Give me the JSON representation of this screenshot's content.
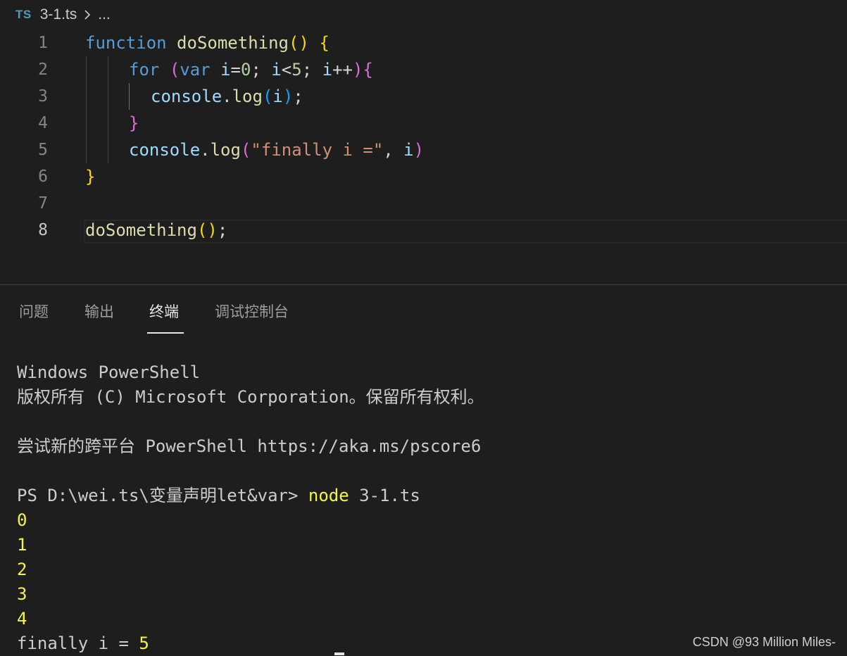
{
  "breadcrumb": {
    "lang_badge": "TS",
    "file": "3-1.ts",
    "more": "..."
  },
  "editor": {
    "line_numbers": [
      "1",
      "2",
      "3",
      "4",
      "5",
      "6",
      "7",
      "8"
    ],
    "current_line": "8",
    "code": {
      "l1": {
        "kw": "function",
        "name": "doSomething",
        "parens": "()",
        "brace": "{"
      },
      "l2": {
        "kw_for": "for",
        "open_paren": "(",
        "kw_var": "var",
        "var_i": "i",
        "eq": "=",
        "zero": "0",
        "semi1": "; ",
        "i2": "i",
        "lt": "<",
        "five": "5",
        "semi2": "; ",
        "i3": "i",
        "inc": "++",
        "close_paren": ")",
        "brace": "{"
      },
      "l3": {
        "obj": "console",
        "dot": ".",
        "method": "log",
        "open": "(",
        "arg": "i",
        "close": ")",
        "semi": ";"
      },
      "l4": {
        "brace": "}"
      },
      "l5": {
        "obj": "console",
        "dot": ".",
        "method": "log",
        "open": "(",
        "str": "\"finally i =\"",
        "comma": ", ",
        "arg": "i",
        "close": ")"
      },
      "l6": {
        "brace": "}"
      },
      "l8": {
        "name": "doSomething",
        "parens": "()",
        "semi": ";"
      }
    }
  },
  "panel": {
    "tabs": [
      "问题",
      "输出",
      "终端",
      "调试控制台"
    ],
    "active_tab": "终端"
  },
  "terminal": {
    "line1": "Windows PowerShell",
    "line2": "版权所有 (C) Microsoft Corporation。保留所有权利。",
    "line3": "尝试新的跨平台 PowerShell https://aka.ms/pscore6",
    "prompt": "PS D:\\wei.ts\\变量声明let&var> ",
    "cmd": "node",
    "cmd_arg": " 3-1.ts",
    "outputs": [
      "0",
      "1",
      "2",
      "3",
      "4"
    ],
    "final_label": "finally i = ",
    "final_value": "5"
  },
  "watermark": "CSDN @93 Million Miles-",
  "colors": {
    "background": "#1e1e1e",
    "keyword": "#569cd6",
    "function": "#dcdcaa",
    "string": "#ce9178",
    "number": "#b5cea8",
    "variable": "#9cdcfe",
    "terminal_yellow": "#f5f543"
  }
}
